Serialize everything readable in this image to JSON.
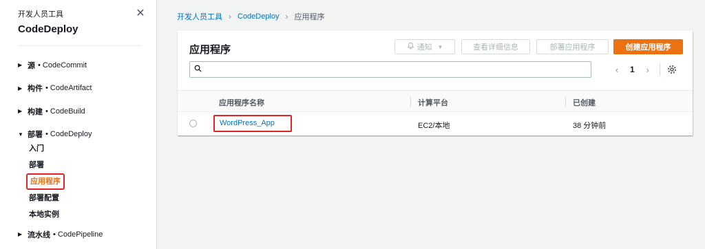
{
  "sidebar": {
    "subtitle": "开发人员工具",
    "title": "CodeDeploy",
    "close_glyph": "✕",
    "groups": [
      {
        "name": "源",
        "service": "• CodeCommit",
        "expanded": false
      },
      {
        "name": "构件",
        "service": "• CodeArtifact",
        "expanded": false
      },
      {
        "name": "构建",
        "service": "• CodeBuild",
        "expanded": false
      },
      {
        "name": "部署",
        "service": "• CodeDeploy",
        "expanded": true
      },
      {
        "name": "流水线",
        "service": "• CodePipeline",
        "expanded": false
      }
    ],
    "deploy_items": [
      "入门",
      "部署",
      "应用程序",
      "部署配置",
      "本地实例"
    ],
    "caret_collapsed": "▶",
    "caret_expanded": "▼"
  },
  "breadcrumb": {
    "items": [
      "开发人员工具",
      "CodeDeploy",
      "应用程序"
    ],
    "separator": "›"
  },
  "panel": {
    "title": "应用程序",
    "notify_label": "通知",
    "view_details_label": "查看详细信息",
    "deploy_app_label": "部署应用程序",
    "create_app_label": "创建应用程序",
    "search_placeholder": "",
    "page_number": "1",
    "prev_glyph": "‹",
    "next_glyph": "›"
  },
  "table": {
    "columns": [
      "应用程序名称",
      "计算平台",
      "已创建"
    ],
    "rows": [
      {
        "name": "WordPress_App",
        "platform": "EC2/本地",
        "created": "38 分钟前"
      }
    ]
  },
  "colors": {
    "accent": "#ec7211",
    "link": "#0073bb",
    "highlight_box": "#e02424"
  }
}
